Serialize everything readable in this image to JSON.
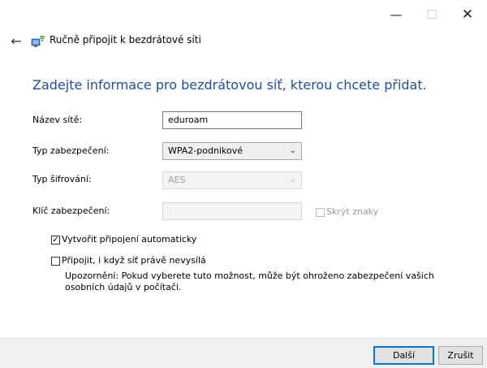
{
  "window": {
    "minimize_glyph": "—",
    "maximize_glyph": "☐",
    "close_glyph": "✕"
  },
  "header": {
    "back_glyph": "←",
    "title": "Ručně připojit k bezdrátové síti",
    "icon": "wireless-network-icon"
  },
  "instruction": "Zadejte informace pro bezdrátovou síť, kterou chcete přidat.",
  "form": {
    "network_name": {
      "label": "Název sítě:",
      "value": "eduroam"
    },
    "security_type": {
      "label": "Typ zabezpečení:",
      "value": "WPA2-podnikové"
    },
    "encryption_type": {
      "label": "Typ šifrování:",
      "value": "AES"
    },
    "security_key": {
      "label": "Klíč zabezpečení:",
      "value": ""
    },
    "hide_characters": {
      "label": "Skrýt znaky",
      "checked": false
    }
  },
  "options": {
    "auto_connect": {
      "label": "Vytvořit připojení automaticky",
      "checked": true
    },
    "connect_even_if_not_broadcasting": {
      "label": "Připojit, i když síť právě nevysílá",
      "checked": false
    },
    "warning": "Upozornění: Pokud vyberete tuto možnost, může být ohroženo zabezpečení vašich osobních údajů v počítači."
  },
  "buttons": {
    "next": "Další",
    "cancel": "Zrušit"
  },
  "colors": {
    "accent": "#0078d7",
    "instruction_text": "#1e4f9c"
  }
}
